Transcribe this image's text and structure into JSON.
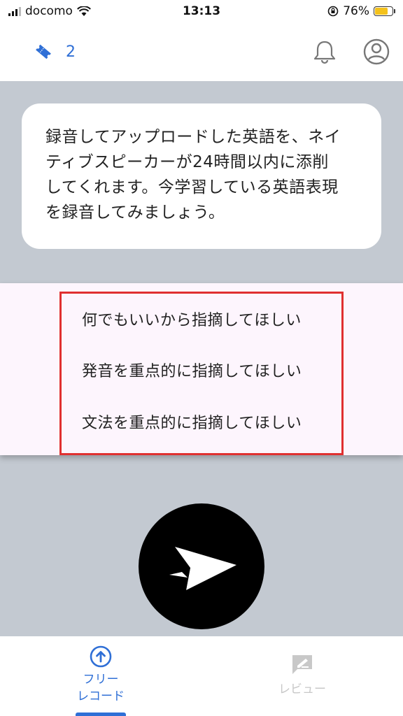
{
  "status_bar": {
    "carrier": "docomo",
    "time": "13:13",
    "battery_percent": "76%",
    "battery_level": 0.76,
    "icons": [
      "signal-icon",
      "wifi-icon",
      "orientation-lock-icon",
      "battery-icon"
    ]
  },
  "header": {
    "ticket_count": "2",
    "icons": [
      "ticket-icon",
      "bell-icon",
      "account-icon"
    ]
  },
  "message": {
    "lines": [
      "録音してアップロードした英語を、ネイ",
      "ティブスピーカーが24時間以内に添削",
      "してくれます。今学習している英語表現",
      "を録音してみましょう。"
    ]
  },
  "menu": {
    "items": [
      "何でもいいから指摘してほしい",
      "発音を重点的に指摘してほしい",
      "文法を重点的に指摘してほしい"
    ]
  },
  "bottom_nav": {
    "free_record_line1": "フリー",
    "free_record_line2": "レコード",
    "review": "レビュー"
  },
  "colors": {
    "accent": "#2f6fd6",
    "backdrop": "#c3c9d1",
    "menu_bg": "#fdf5fd",
    "highlight": "#e03030",
    "battery": "#f4c21c"
  }
}
